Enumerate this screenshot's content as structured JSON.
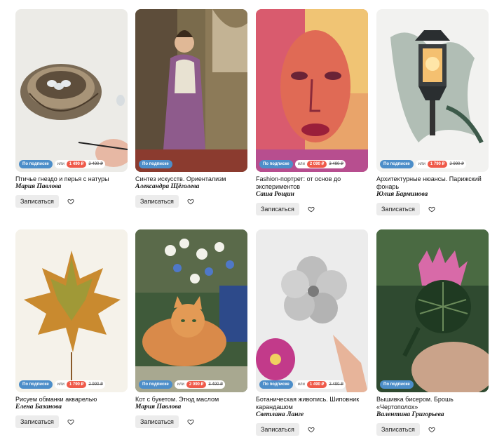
{
  "courses": [
    {
      "title": "Птичье гнездо и перья с натуры",
      "author": "Мария Павлова",
      "subscription": "По подписке",
      "or": "или",
      "price": "1 490 ₽",
      "old_price": "2 490 ₽",
      "cta": "Записаться",
      "image": "bird-nest-painting"
    },
    {
      "title": "Синтез искусств. Ориентализм",
      "author": "Александра Щёголева",
      "subscription": "По подписке",
      "image": "orientalist-woman-painting",
      "cta": "Записаться"
    },
    {
      "title": "Fashion-портрет: от основ до экспериментов",
      "author": "Саша Рощин",
      "subscription": "По подписке",
      "or": "или",
      "price": "2 090 ₽",
      "old_price": "3 490 ₽",
      "cta": "Записаться",
      "image": "watercolor-face-portrait"
    },
    {
      "title": "Архитектурные нюансы. Парижский фонарь",
      "author": "Юлия Барминова",
      "subscription": "По подписке",
      "or": "или",
      "price": "1 790 ₽",
      "old_price": "2 990 ₽",
      "cta": "Записаться",
      "image": "street-lantern-painting"
    },
    {
      "title": "Рисуем обманки акварелью",
      "author": "Елена Базанова",
      "subscription": "По подписке",
      "or": "или",
      "price": "1 790 ₽",
      "old_price": "2 990 ₽",
      "cta": "Записаться",
      "image": "maple-leaf-watercolor"
    },
    {
      "title": "Кот с букетом. Этюд маслом",
      "author": "Мария Павлова",
      "subscription": "По подписке",
      "or": "или",
      "price": "2 090 ₽",
      "old_price": "3 490 ₽",
      "cta": "Записаться",
      "image": "cat-with-bouquet-painting"
    },
    {
      "title": "Ботаническая живопись. Шиповник карандашом",
      "author": "Светлана Ланге",
      "subscription": "По подписке",
      "or": "или",
      "price": "1 490 ₽",
      "old_price": "2 490 ₽",
      "cta": "Записаться",
      "image": "rosehip-pencil-drawing"
    },
    {
      "title": "Вышивка бисером. Брошь «Чертополох»",
      "author": "Валентина Григорьева",
      "subscription": "По подписке",
      "cta": "Записаться",
      "image": "thistle-bead-brooch"
    }
  ],
  "colors": {
    "subscription_badge": "#4d8ec9",
    "price_badge": "#ef5a4a",
    "button_bg": "#ececec"
  },
  "icons": {
    "favorite": "heart-outline-icon"
  }
}
